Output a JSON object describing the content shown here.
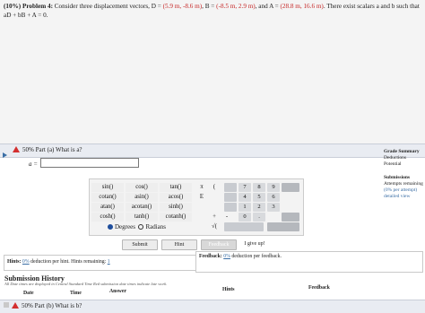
{
  "problem": {
    "prefix": "(10%) Problem 4:",
    "text_1": "Consider three displacement vectors, D = ",
    "D_val": "(5.9 m, -8.6 m)",
    "text_2": ", B = ",
    "B_val": "(-8.5 m, 2.9 m)",
    "text_3": ", and A = ",
    "A_val": "(28.8 m, 16.6 m)",
    "text_4": ". There exist scalars a and b such that aD + bB + A = 0."
  },
  "part_a": {
    "title": "50% Part (a)  What is a?",
    "answer_label": "a =",
    "answer_value": ""
  },
  "calculator": {
    "functions": [
      "sin()",
      "cos()",
      "tan()",
      "cotan()",
      "asin()",
      "acos()",
      "atan()",
      "acotan()",
      "sinh()",
      "cosh()",
      "tanh()",
      "cotanh()"
    ],
    "symbols": [
      "π",
      "(",
      "E",
      "",
      "+",
      "-",
      "√(",
      ""
    ],
    "keypad": [
      "7",
      "8",
      "9",
      "4",
      "5",
      "6",
      "1",
      "2",
      "3",
      "0",
      "."
    ],
    "degrees_label": "Degrees",
    "radians_label": "Radians",
    "mode_selected": "Degrees"
  },
  "buttons": {
    "submit": "Submit",
    "hint": "Hint",
    "feedback": "Feedback",
    "give_up": "I give up!"
  },
  "hints": {
    "text_1": "Hints: ",
    "pct": "0%",
    "text_2": " deduction per hint. Hints remaining: ",
    "remaining": "1"
  },
  "feedback": {
    "text_1": "Feedback: ",
    "pct": "0%",
    "text_2": " deduction per feedback."
  },
  "side": {
    "grade_summary": "Grade Summary",
    "deductions": "Deductions",
    "potential": "Potential",
    "submissions": "Submissions",
    "attempts": "Attempts remaining",
    "per_attempt": "(0% per attempt)",
    "detailed_view": "detailed view"
  },
  "history": {
    "title": "Submission History",
    "note": "All Date times are displayed in Central Standard Time Red submission date times indicate late work.",
    "columns": [
      "Date",
      "Time",
      "Answer",
      "Hints",
      "Feedback"
    ]
  },
  "part_b": {
    "title": "50% Part (b)  What is b?"
  },
  "colors": {
    "accent_red": "#c62828",
    "link_blue": "#3a6ea5",
    "radio_selected": "#1f4e9c"
  }
}
